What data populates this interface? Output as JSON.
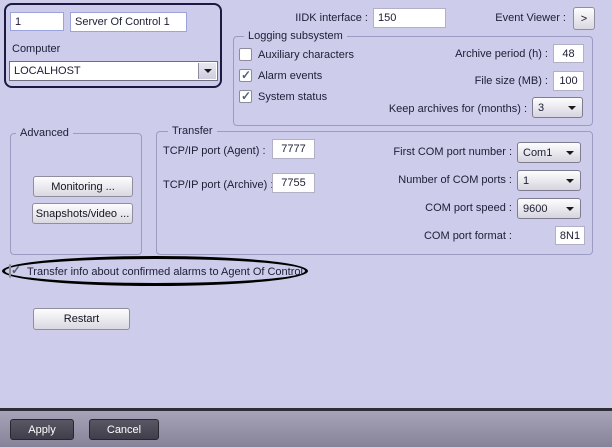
{
  "colors": {
    "background": "#cdccea",
    "group_border": "#9d9bc4",
    "identity_border": "#1b1b42",
    "footer_bar": "#908da3",
    "footer_button": "#454350",
    "highlight_ellipse": "#000000",
    "checkmark": "#4e6377"
  },
  "identity": {
    "id_value": "1",
    "name_value": "Server Of Control 1",
    "computer_label": "Computer",
    "computer_value": "LOCALHOST"
  },
  "header": {
    "iidk_label": "IIDK interface :",
    "iidk_value": "150",
    "event_viewer_label": "Event Viewer :",
    "event_viewer_button": ">"
  },
  "logging": {
    "title": "Logging subsystem",
    "checkboxes": [
      {
        "label": "Auxiliary characters",
        "checked": false
      },
      {
        "label": "Alarm events",
        "checked": true
      },
      {
        "label": "System status",
        "checked": true
      }
    ],
    "archive_label": "Archive period (h) :",
    "archive_value": "48",
    "filesize_label": "File size (MB) :",
    "filesize_value": "100",
    "keep_label": "Keep archives for (months) :",
    "keep_value": "3"
  },
  "advanced": {
    "title": "Advanced",
    "buttons": [
      "Monitoring ...",
      "Snapshots/video ..."
    ]
  },
  "transfer": {
    "title": "Transfer",
    "agent_label": "TCP/IP port (Agent) :",
    "agent_value": "7777",
    "archive_label": "TCP/IP port (Archive) :",
    "archive_value": "7755",
    "com_number_label": "First COM port number :",
    "com_number_value": "Com1",
    "com_count_label": "Number of COM ports :",
    "com_count_value": "1",
    "com_speed_label": "COM port speed :",
    "com_speed_value": "9600",
    "com_format_label": "COM port format :",
    "com_format_value": "8N1"
  },
  "highlight": {
    "label": "Transfer info about confirmed alarms to Agent Of Control",
    "checked": true
  },
  "restart_label": "Restart",
  "footer": {
    "apply_label": "Apply",
    "cancel_label": "Cancel"
  }
}
